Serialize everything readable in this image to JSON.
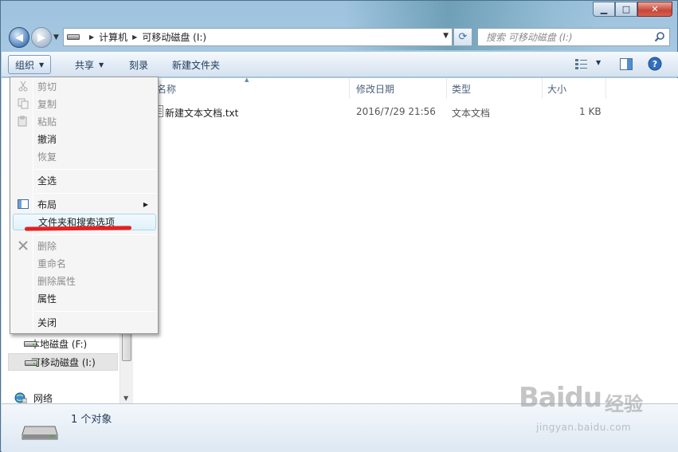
{
  "window": {
    "controls": {
      "minimize": "▁",
      "maximize": "□",
      "close": "✕"
    }
  },
  "address_bar": {
    "path": [
      "计算机",
      "可移动磁盘 (I:)"
    ],
    "search_placeholder": "搜索 可移动磁盘 (I:)"
  },
  "toolbar": {
    "organize": "组织",
    "share": "共享",
    "burn": "刻录",
    "new_folder": "新建文件夹"
  },
  "file_list": {
    "columns": [
      "名称",
      "修改日期",
      "类型",
      "大小"
    ],
    "rows": [
      {
        "name": "新建文本文档.txt",
        "modified": "2016/7/29 21:56",
        "type": "文本文档",
        "size": "1 KB"
      }
    ]
  },
  "nav_pane": {
    "items": [
      {
        "label": "本地磁盘 (F:)",
        "selected": false
      },
      {
        "label": "可移动磁盘 (I:)",
        "selected": true
      },
      {
        "label": "网络",
        "selected": false
      }
    ]
  },
  "organize_menu": {
    "cut": "剪切",
    "copy": "复制",
    "paste": "粘贴",
    "undo": "撤消",
    "redo": "恢复",
    "select_all": "全选",
    "layout": "布局",
    "folder_options": "文件夹和搜索选项",
    "delete": "删除",
    "rename": "重命名",
    "remove_properties": "删除属性",
    "properties": "属性",
    "close": "关闭"
  },
  "status_bar": {
    "count": "1 个对象"
  },
  "watermark": {
    "brand": "Baidu",
    "brand_cn": "经验",
    "url": "jingyan.baidu.com"
  },
  "colors": {
    "highlight_underline": "#e62020",
    "toolbar_text": "#1e395b"
  }
}
